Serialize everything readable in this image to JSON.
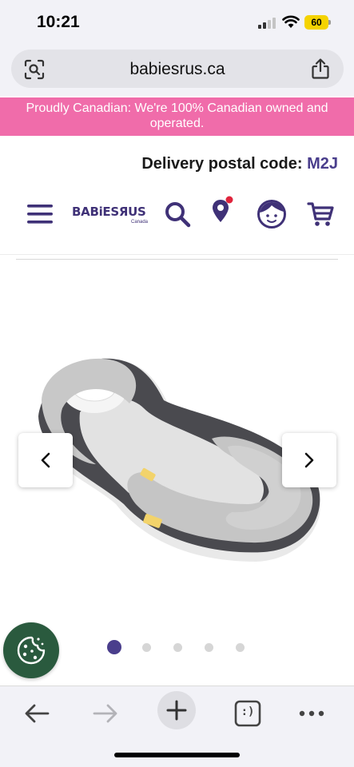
{
  "status_bar": {
    "time": "10:21",
    "battery": "60",
    "battery_color": "#f5d300",
    "icons": [
      "signal-icon",
      "wifi-icon",
      "battery-icon"
    ]
  },
  "browser": {
    "url": "babiesrus.ca",
    "left_icon": "page-lens-icon",
    "right_icon": "share-icon"
  },
  "promo": {
    "text": "Proudly Canadian: We're 100% Canadian owned and operated.",
    "background": "#f06caa"
  },
  "delivery": {
    "label": "Delivery postal code:",
    "code": "M2J"
  },
  "header": {
    "brand": "BABiESЯUS",
    "brand_sub": "Canada",
    "brand_color": "#3f3177",
    "icons": [
      "menu-icon",
      "search-icon",
      "store-location-icon",
      "account-icon",
      "cart-icon"
    ]
  },
  "carousel": {
    "image": "baby-positioner-product-image",
    "prev_icon": "chevron-left-icon",
    "next_icon": "chevron-right-icon",
    "dots_count": 5,
    "active_index": 0,
    "active_color": "#4a3e8c"
  },
  "cookie": {
    "icon": "cookie-icon",
    "color": "#2a5a3e"
  },
  "toolbar": {
    "icons": [
      "back-arrow-icon",
      "forward-arrow-icon",
      "new-tab-plus-icon",
      "tabs-icon",
      "more-icon"
    ],
    "tabs_label": ":)"
  }
}
